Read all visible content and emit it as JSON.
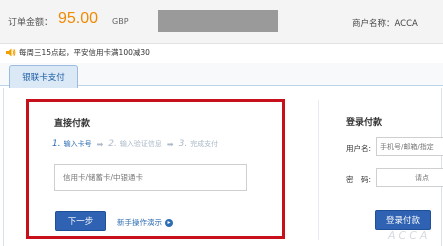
{
  "order": {
    "amount_label": "订单金额：",
    "amount": "95.00",
    "currency": "GBP",
    "merchant_label": "商户名称：",
    "merchant_name": "ACCA"
  },
  "notice": {
    "icon": "speaker-icon",
    "text": "每周三15点起，平安信用卡满100减30"
  },
  "tabs": [
    {
      "label": "银联卡支付",
      "active": true
    }
  ],
  "direct_pay": {
    "title": "直接付款",
    "steps": [
      {
        "num": "1.",
        "label": "输入卡号",
        "active": true
      },
      {
        "num": "2.",
        "label": "输入验证信息",
        "active": false
      },
      {
        "num": "3.",
        "label": "完成支付",
        "active": false
      }
    ],
    "card_input_placeholder": "信用卡/储蓄卡/中银通卡",
    "next_button": "下一步",
    "guide_link": "新手操作演示"
  },
  "login_pay": {
    "title": "登录付款",
    "username_label": "用户名:",
    "username_placeholder": "手机号/邮箱/指定",
    "password_label": "密　码:",
    "password_hint": "请点",
    "login_button": "登录付款"
  },
  "watermark": "ACCA",
  "colors": {
    "amount": "#f08a00",
    "highlight_border": "#c7101c",
    "button": "#2f62b3",
    "link": "#2e6db2"
  }
}
